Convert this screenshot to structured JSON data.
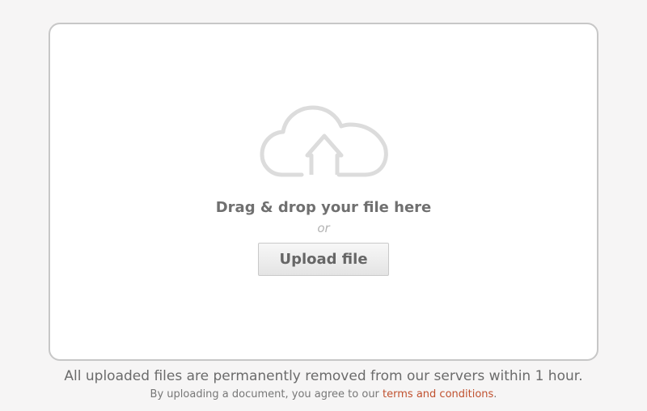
{
  "dropzone": {
    "icon": "cloud-upload-icon",
    "headline": "Drag & drop your file here",
    "separator": "or",
    "upload_button_label": "Upload file"
  },
  "footer": {
    "notice": "All uploaded files are permanently removed from our servers within 1 hour.",
    "terms_prefix": "By uploading a document, you agree to our ",
    "terms_link": "terms and conditions",
    "terms_suffix": "."
  },
  "colors": {
    "background": "#f6f5f5",
    "border": "#c7c7c7",
    "icon": "#dcdcdc",
    "link": "#c0512f"
  }
}
